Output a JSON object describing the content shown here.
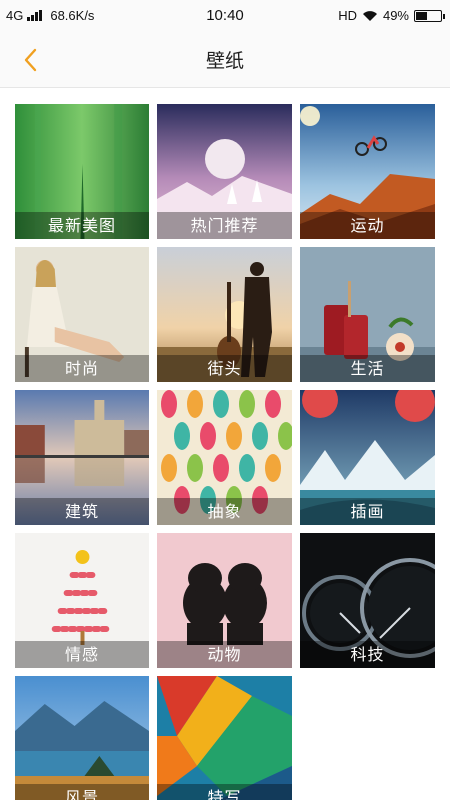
{
  "status_bar": {
    "network": "4G",
    "speed": "68.6K/s",
    "time": "10:40",
    "hd": "HD",
    "battery_percent": "49%",
    "battery_level": 0.49
  },
  "header": {
    "title": "壁纸",
    "back_icon": "chevron-left-icon",
    "accent_color": "#f0a020"
  },
  "categories": [
    {
      "label": "最新美图"
    },
    {
      "label": "热门推荐"
    },
    {
      "label": "运动"
    },
    {
      "label": "时尚"
    },
    {
      "label": "街头"
    },
    {
      "label": "生活"
    },
    {
      "label": "建筑"
    },
    {
      "label": "抽象"
    },
    {
      "label": "插画"
    },
    {
      "label": "情感"
    },
    {
      "label": "动物"
    },
    {
      "label": "科技"
    },
    {
      "label": "风景"
    },
    {
      "label": "特写"
    }
  ]
}
